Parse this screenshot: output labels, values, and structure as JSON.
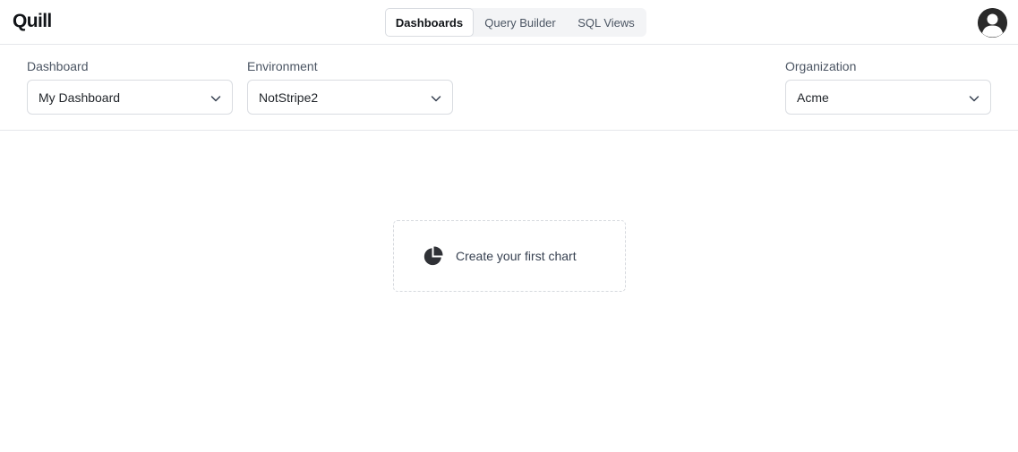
{
  "header": {
    "logo": "Quill",
    "tabs": [
      {
        "label": "Dashboards",
        "active": true
      },
      {
        "label": "Query Builder",
        "active": false
      },
      {
        "label": "SQL Views",
        "active": false
      }
    ],
    "avatar_icon": "user-avatar-icon"
  },
  "filters": {
    "dashboard": {
      "label": "Dashboard",
      "value": "My Dashboard"
    },
    "environment": {
      "label": "Environment",
      "value": "NotStripe2"
    },
    "organization": {
      "label": "Organization",
      "value": "Acme"
    }
  },
  "empty_state": {
    "icon": "pie-chart-icon",
    "label": "Create your first chart"
  },
  "colors": {
    "border": "#e5e7eb",
    "tab_bg": "#f3f4f6",
    "icon_dark": "#2a2a2a"
  }
}
